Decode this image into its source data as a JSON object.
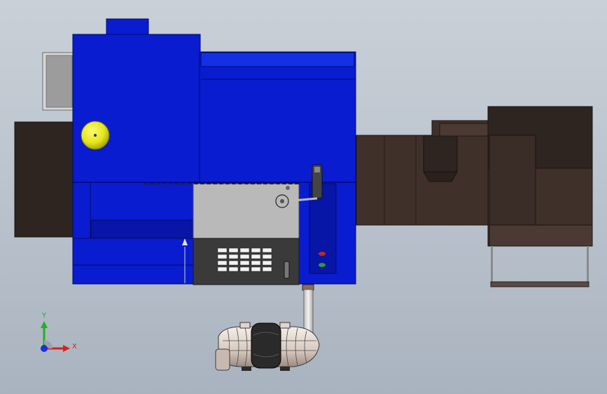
{
  "scene": {
    "background_top": "#c9d0d8",
    "background_bottom": "#a9b3bf",
    "colors": {
      "machine_body": "#0a1ccf",
      "machine_body_dark": "#0716a6",
      "machine_body_light": "#1430e6",
      "brown_dark": "#2e2420",
      "brown": "#3f302a",
      "brown_light": "#4b3a33",
      "panel_grey": "#b9b9b9",
      "control_dark": "#3a3a3a",
      "knob_yellow": "#e6e61a",
      "gray_box": "#9c9c9c",
      "pipe": "#d9d9d9",
      "motor_skin": "#e8ded6",
      "motor_dark": "#2a2a2a"
    },
    "indicator_lights": [
      "#c0281f",
      "#2f9d2f"
    ]
  },
  "triad": {
    "y_label": "Y",
    "x_label": "X",
    "y_color": "#21b021",
    "x_color": "#d82020",
    "z_color": "#1c2fd8"
  }
}
